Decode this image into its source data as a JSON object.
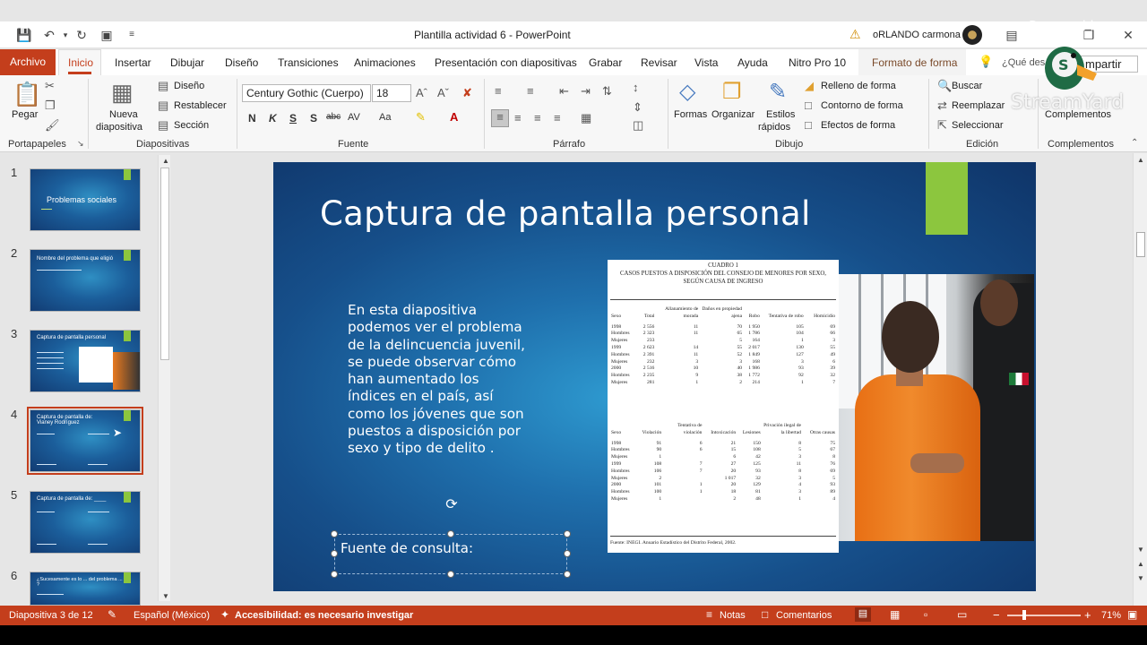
{
  "window": {
    "doc_title": "Plantilla actividad 6  -  PowerPoint",
    "user_name": "oRLANDO carmona"
  },
  "tabs": {
    "archivo": "Archivo",
    "inicio": "Inicio",
    "insertar": "Insertar",
    "dibujar": "Dibujar",
    "diseno": "Diseño",
    "transiciones": "Transiciones",
    "animaciones": "Animaciones",
    "presentacion": "Presentación con diapositivas",
    "grabar": "Grabar",
    "revisar": "Revisar",
    "vista": "Vista",
    "ayuda": "Ayuda",
    "nitro": "Nitro Pro 10",
    "formato": "Formato de forma",
    "search": "¿Qué des",
    "compartir": "mpartir"
  },
  "ribbon": {
    "portapapeles": {
      "label": "Portapapeles",
      "pegar": "Pegar"
    },
    "diapositivas": {
      "label": "Diapositivas",
      "nueva_1": "Nueva",
      "nueva_2": "diapositiva",
      "diseno": "Diseño",
      "restablecer": "Restablecer",
      "seccion": "Sección"
    },
    "fuente": {
      "label": "Fuente",
      "font_name": "Century Gothic (Cuerpo)",
      "font_size": "18",
      "bold": "N",
      "italic": "K",
      "underline": "S",
      "shadow": "S",
      "strike": "abc",
      "spacing": "AV",
      "case": "Aa"
    },
    "parrafo": {
      "label": "Párrafo"
    },
    "dibujo": {
      "label": "Dibujo",
      "formas": "Formas",
      "organizar": "Organizar",
      "estilos_1": "Estilos",
      "estilos_2": "rápidos",
      "relleno": "Relleno de forma",
      "contorno": "Contorno de forma",
      "efectos": "Efectos de forma"
    },
    "edicion": {
      "label": "Edición",
      "buscar": "Buscar",
      "reemplazar": "Reemplazar",
      "seleccionar": "Seleccionar"
    },
    "complementos": {
      "label": "Complementos",
      "btn": "Complementos"
    }
  },
  "thumbnails": [
    {
      "num": "1",
      "title": "Problemas sociales"
    },
    {
      "num": "2",
      "title": "Nombre del problema que eligió"
    },
    {
      "num": "3",
      "title": "Captura de pantalla personal"
    },
    {
      "num": "4",
      "title": "Captura de pantalla de: Vianey Rodríguez"
    },
    {
      "num": "5",
      "title": "Captura de pantalla de: ____"
    },
    {
      "num": "6",
      "title": "¿Sucesamente es lo ... del problema ... ?"
    }
  ],
  "slide": {
    "title": "Captura de pantalla personal",
    "body": "En esta diapositiva podemos ver el problema de la delincuencia juvenil, se puede observar cómo han aumentado los índices en el país, así como los jóvenes que son puestos a disposición por sexo y tipo de delito .",
    "source": "Fuente de consulta:"
  },
  "table_image": {
    "title_1": "CUADRO 1",
    "title_2": "CASOS PUESTOS A DISPOSICIÓN DEL CONSEJO DE MENORES POR SEXO,",
    "title_3": "SEGÚN CAUSA DE INGRESO",
    "headers_1": [
      "Sexo",
      "Total",
      "Allanamiento de morada",
      "Daños en propiedad ajena",
      "Robo",
      "Tentativa de robo",
      "Homicidio"
    ],
    "rows_1": [
      [
        "1998",
        "2 556",
        "11",
        "70",
        "1 950",
        "105",
        "69"
      ],
      [
        "Hombres",
        "2 323",
        "11",
        "65",
        "1 786",
        "104",
        "66"
      ],
      [
        "Mujeres",
        "233",
        "",
        "5",
        "164",
        "1",
        "3"
      ],
      [
        "1999",
        "2 623",
        "14",
        "55",
        "2 017",
        "130",
        "55"
      ],
      [
        "Hombres",
        "2 391",
        "11",
        "52",
        "1 849",
        "127",
        "49"
      ],
      [
        "Mujeres",
        "232",
        "3",
        "3",
        "168",
        "3",
        "6"
      ],
      [
        "2000",
        "2 516",
        "10",
        "40",
        "1 986",
        "93",
        "39"
      ],
      [
        "Hombres",
        "2 235",
        "9",
        "38",
        "1 772",
        "92",
        "32"
      ],
      [
        "Mujeres",
        "281",
        "1",
        "2",
        "214",
        "1",
        "7"
      ]
    ],
    "headers_2": [
      "Sexo",
      "Violación",
      "Tentativa de violación",
      "Intoxicación",
      "Lesiones",
      "Privación ilegal de la libertad",
      "Otras causas"
    ],
    "rows_2": [
      [
        "1998",
        "91",
        "6",
        "21",
        "150",
        "8",
        "75"
      ],
      [
        "Hombres",
        "90",
        "6",
        "15",
        "108",
        "5",
        "67"
      ],
      [
        "Mujeres",
        "1",
        "",
        "6",
        "42",
        "3",
        "8"
      ],
      [
        "1999",
        "108",
        "7",
        "27",
        "125",
        "11",
        "76"
      ],
      [
        "Hombres",
        "106",
        "7",
        "20",
        "93",
        "8",
        "69"
      ],
      [
        "Mujeres",
        "2",
        "",
        "1 017",
        "32",
        "3",
        "5"
      ],
      [
        "2000",
        "101",
        "1",
        "20",
        "129",
        "4",
        "93"
      ],
      [
        "Hombres",
        "100",
        "1",
        "18",
        "81",
        "3",
        "89"
      ],
      [
        "Mujeres",
        "1",
        "",
        "2",
        "48",
        "1",
        "4"
      ]
    ],
    "footer": "Fuente: INEGI. Anuario Estadístico del Distrito Federal, 2002."
  },
  "status": {
    "slide_count": "Diapositiva 3 de 12",
    "language": "Español (México)",
    "accessibility": "Accesibilidad: es necesario investigar",
    "notas": "Notas",
    "comentarios": "Comentarios",
    "zoom": "71%"
  },
  "overlay": {
    "powered_by": "Powered by",
    "streamyard": "StreamYard"
  },
  "colors": {
    "accent": "#c43e1c",
    "slide_green": "#8cc63e",
    "slide_blue": "#164f8a"
  }
}
